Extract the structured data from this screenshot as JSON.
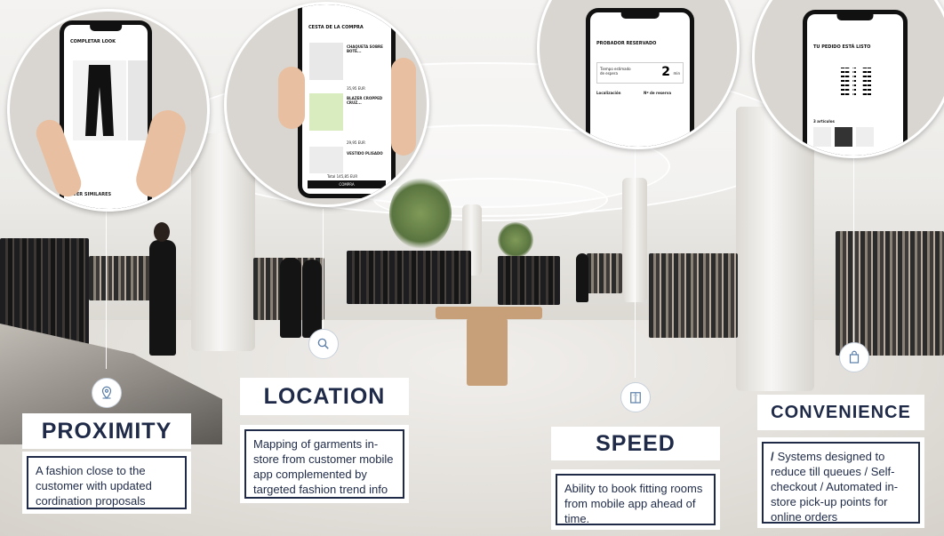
{
  "sections": {
    "proximity": {
      "heading": "PROXIMITY",
      "description": "A fashion close to the customer with updated cordination proposals",
      "icon": "location-pin-icon"
    },
    "location": {
      "heading": "LOCATION",
      "description": "Mapping of garments in-store from customer mobile app complemented by targeted fashion trend info",
      "icon": "search-icon"
    },
    "speed": {
      "heading": "SPEED",
      "description": "Ability to book fitting rooms from mobile app ahead of time.",
      "icon": "fitting-room-icon"
    },
    "convenience": {
      "heading": "CONVENIENCE",
      "slash": "/",
      "description": "Systems designed to reduce till queues / Self-checkout / Automated in-store pick-up points for online orders",
      "icon": "shopping-bag-icon"
    }
  },
  "phones": {
    "phone1": {
      "title": "COMPLETAR LOOK",
      "footer": "VER SIMILARES"
    },
    "phone2": {
      "title": "CESTA DE LA COMPRA",
      "item1": "CHAQUETA SOBRE BOTÉ...",
      "item2": "BLAZER CROPPED CRUZ...",
      "item3": "VESTIDO PLISADO",
      "total": "Total 145,85 EUR",
      "button": "COMPRA",
      "price1": "35,95 EUR",
      "price2": "29,95 EUR"
    },
    "phone3": {
      "title": "PROBADOR RESERVADO",
      "wait_label": "Tiempo estimado de espera",
      "wait_value": "2",
      "wait_unit": "min",
      "location_label": "Localización",
      "queue_label": "Nº de reserva"
    },
    "phone4": {
      "title": "TU PEDIDO ESTÁ LISTO",
      "items_label": "3 artículos"
    }
  },
  "colors": {
    "navy": "#1e2a47",
    "white": "#ffffff"
  }
}
